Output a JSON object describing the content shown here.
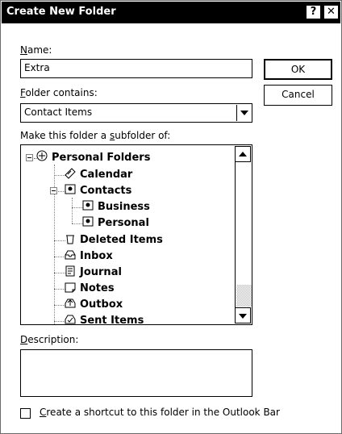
{
  "dialog": {
    "title": "Create New Folder",
    "help_glyph": "?",
    "close_glyph": "✕"
  },
  "name": {
    "label_accel": "N",
    "label_rest": "ame:",
    "value": "Extra"
  },
  "folder_contains": {
    "label_accel": "F",
    "label_rest": "older contains:",
    "selected": "Contact Items"
  },
  "subfolder_label": {
    "before": "Make this folder a ",
    "accel": "s",
    "after": "ubfolder of:"
  },
  "tree": {
    "items": [
      {
        "label": "Personal Folders",
        "icon": "personal-folders-icon"
      },
      {
        "label": "Calendar",
        "icon": "calendar-icon"
      },
      {
        "label": "Contacts",
        "icon": "contacts-icon"
      },
      {
        "label": "Business",
        "icon": "contacts-icon"
      },
      {
        "label": "Personal",
        "icon": "contacts-icon"
      },
      {
        "label": "Deleted Items",
        "icon": "deleted-items-icon"
      },
      {
        "label": "Inbox",
        "icon": "inbox-icon"
      },
      {
        "label": "Journal",
        "icon": "journal-icon"
      },
      {
        "label": "Notes",
        "icon": "notes-icon"
      },
      {
        "label": "Outbox",
        "icon": "outbox-icon"
      },
      {
        "label": "Sent Items",
        "icon": "sent-items-icon"
      }
    ]
  },
  "buttons": {
    "ok": "OK",
    "cancel": "Cancel"
  },
  "description": {
    "label_accel": "D",
    "label_rest": "escription:",
    "value": ""
  },
  "shortcut": {
    "accel": "C",
    "rest": "reate a shortcut to this folder in the Outlook Bar",
    "checked": false
  }
}
